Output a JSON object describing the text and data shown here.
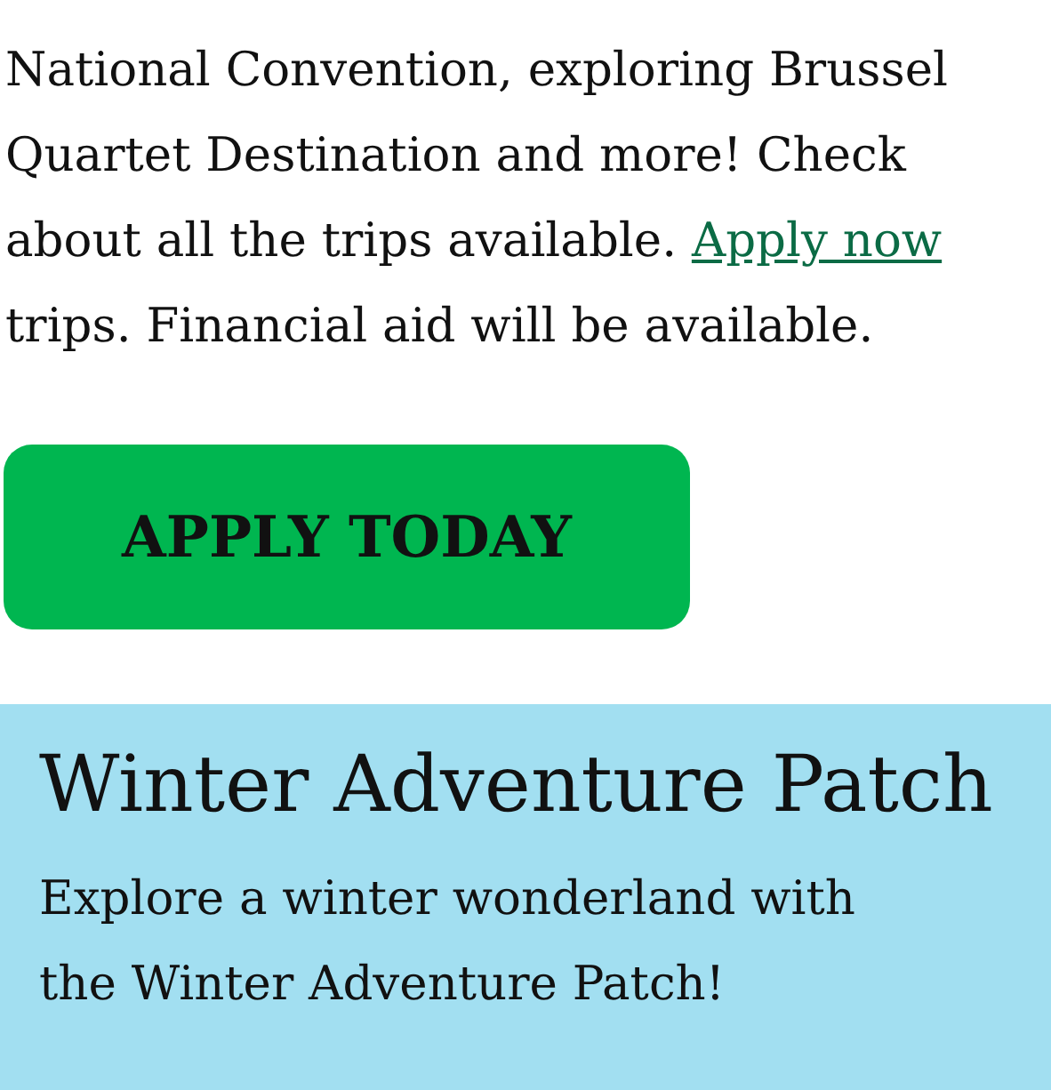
{
  "intro": {
    "lines": [
      "National Convention, exploring Brussel",
      "Quartet Destination and more! Check",
      "about all the trips available."
    ],
    "link": "Apply now",
    "last_line": "trips. Financial aid will be available."
  },
  "button": {
    "label": "APPLY TODAY"
  },
  "patch": {
    "title": "Winter Adventure Patch",
    "text": "Explore a winter wonderland with the Winter Adventure Patch!"
  }
}
